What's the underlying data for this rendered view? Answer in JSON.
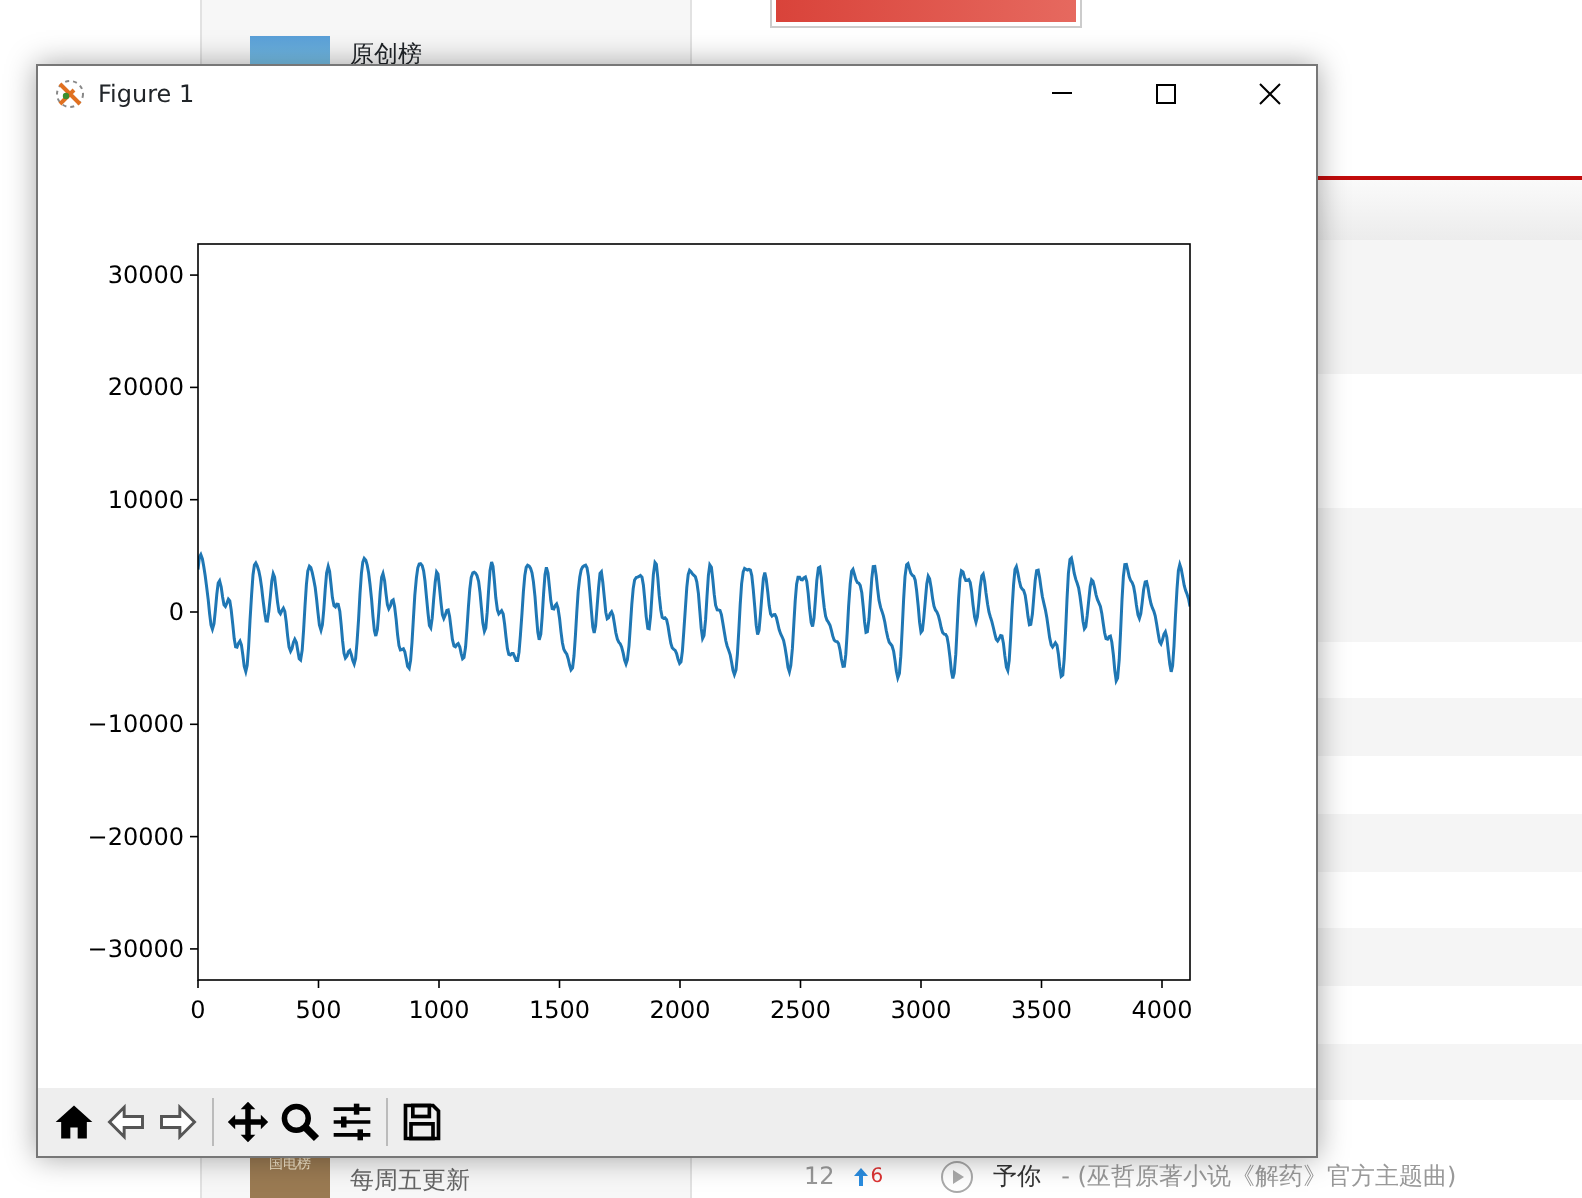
{
  "background_page": {
    "sidebar": [
      {
        "title": "原创榜"
      },
      {
        "thumb_label": "国电榜",
        "subtitle": "每周五更新"
      }
    ],
    "song_row": {
      "rank": "12",
      "change": "6",
      "title": "予你",
      "subtitle": "- (巫哲原著小说《解药》官方主题曲)"
    }
  },
  "window": {
    "title": "Figure 1",
    "plot": {
      "yticks": [
        "30000",
        "20000",
        "10000",
        "0",
        "−10000",
        "−20000",
        "−30000"
      ],
      "xticks": [
        "0",
        "500",
        "1000",
        "1500",
        "2000",
        "2500",
        "3000",
        "3500",
        "4000"
      ]
    }
  }
}
